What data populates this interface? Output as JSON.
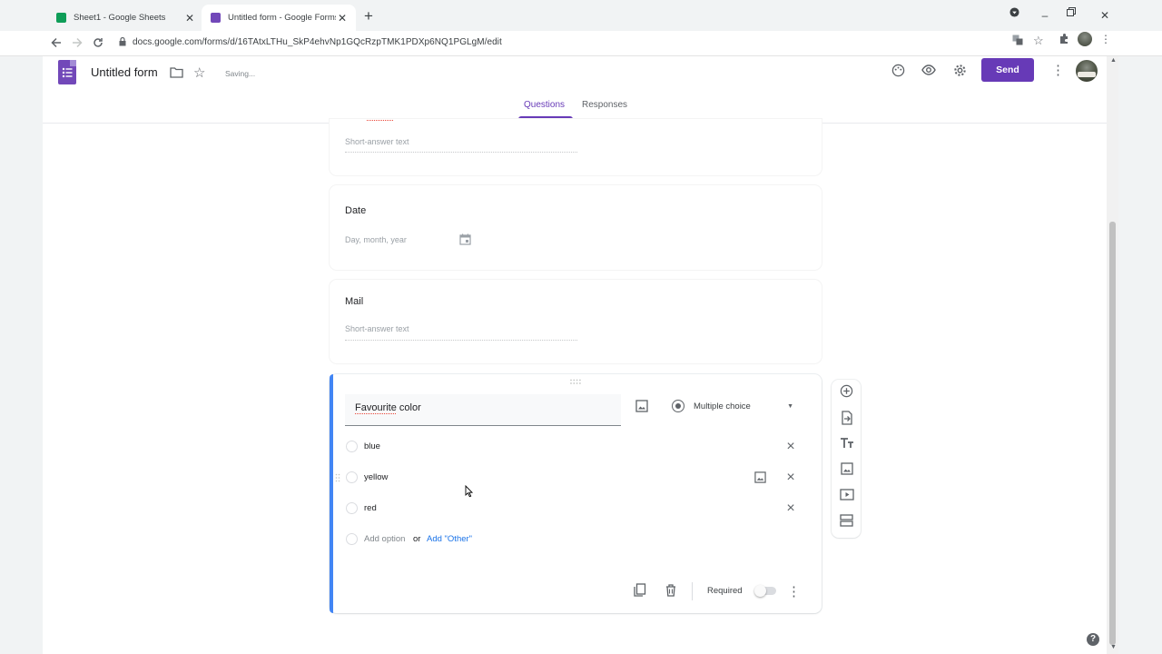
{
  "browser": {
    "tabs": [
      {
        "title": "Sheet1 - Google Sheets",
        "favicon_color": "#0f9d58"
      },
      {
        "title": "Untitled form - Google Forms",
        "favicon_color": "#7248b9"
      }
    ],
    "url": "docs.google.com/forms/d/16TAtxLTHu_SkP4ehvNp1GQcRzpTMK1PDXp6NQ1PGLgM/edit"
  },
  "header": {
    "form_title": "Untitled form",
    "status": "Saving...",
    "send_label": "Send",
    "accent_color": "#673ab7"
  },
  "tabs": {
    "questions": "Questions",
    "responses": "Responses"
  },
  "questions": [
    {
      "title": "",
      "hint": "Short-answer text"
    },
    {
      "title": "Date",
      "hint": "Day, month, year"
    },
    {
      "title": "Mail",
      "hint": "Short-answer text"
    }
  ],
  "active_question": {
    "title": "Favourite color",
    "type": "Multiple choice",
    "options": [
      "blue",
      "yellow",
      "red"
    ],
    "add_option": "Add option",
    "or_text": "or",
    "add_other": "Add \"Other\"",
    "required_label": "Required",
    "required": false
  }
}
